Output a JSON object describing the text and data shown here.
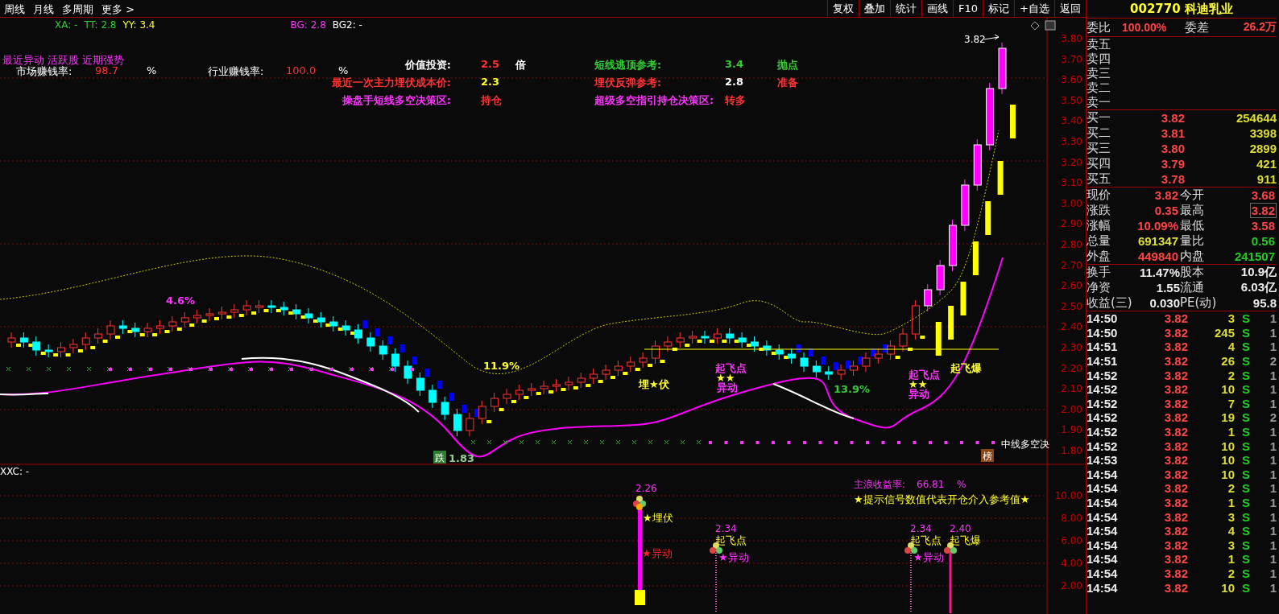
{
  "toolbar": {
    "periods": [
      "周线",
      "月线",
      "多周期",
      "更多 >"
    ],
    "buttons": [
      "复权",
      "叠加",
      "统计",
      "画线",
      "F10",
      "标记",
      "+自选",
      "返回"
    ]
  },
  "legend": [
    {
      "text": "XA: -",
      "color": "#33cc33"
    },
    {
      "text": "TT: 2.8",
      "color": "#33cc33"
    },
    {
      "text": "YY: 3.4",
      "color": "#ffff33"
    },
    {
      "text": "BG: 2.8",
      "color": "#ff33ff"
    },
    {
      "text": "BG2: -",
      "color": "#ffffff"
    }
  ],
  "info": {
    "title": "最近异动 活跃股 近期强势",
    "rates": [
      {
        "label": "市场赚钱率:",
        "value": "98.7",
        "unit": "%"
      },
      {
        "label": "行业赚钱率:",
        "value": "100.0",
        "unit": "%"
      }
    ],
    "rows": [
      {
        "a": {
          "label": {
            "text": "价值投资:",
            "color": "#ffffff"
          },
          "value": {
            "text": "2.5",
            "color": "#ff3333"
          },
          "unit": {
            "text": "倍",
            "color": "#ffffff"
          }
        },
        "b": {
          "label": {
            "text": "短线逃顶参考:",
            "color": "#33cc33"
          },
          "value": {
            "text": "3.4",
            "color": "#33cc33"
          },
          "unit": {
            "text": "抛点",
            "color": "#33cc33"
          }
        }
      },
      {
        "a": {
          "label": {
            "text": "最近一次主力埋伏成本价:",
            "color": "#ff3333"
          },
          "value": {
            "text": "2.3",
            "color": "#ffff33"
          }
        },
        "b": {
          "label": {
            "text": "埋伏反弹参考:",
            "color": "#ff3333"
          },
          "value": {
            "text": "2.8",
            "color": "#ffffff"
          },
          "unit": {
            "text": "准备",
            "color": "#ff3333"
          }
        }
      },
      {
        "a": {
          "label": {
            "text": "操盘手短线多空决策区:",
            "color": "#ff33ff"
          },
          "value": {
            "text": "持仓",
            "color": "#ff3333"
          }
        },
        "b": {
          "label": {
            "text": "超级多空指引持仓决策区:",
            "color": "#ff33ff"
          },
          "value": {
            "text": "转多",
            "color": "#ff3333"
          }
        }
      }
    ]
  },
  "chart": {
    "last_price": "3.82",
    "side_label": "中线多空决",
    "axis": [
      "3.80",
      "3.70",
      "3.60",
      "3.50",
      "3.40",
      "3.30",
      "3.20",
      "3.10",
      "3.00",
      "2.90",
      "2.80",
      "2.70",
      "2.60",
      "2.50",
      "2.40",
      "2.30",
      "2.20",
      "2.10",
      "2.00",
      "1.90",
      "1.80"
    ],
    "annotations": [
      {
        "text": "4.6%",
        "color": "#ff33ff"
      },
      {
        "text": "11.9%",
        "color": "#ffff33"
      },
      {
        "text": "1.83",
        "color": "#99cc99"
      },
      {
        "text": "13.9%",
        "color": "#33cc33"
      },
      {
        "text": "埋★伏",
        "color": "#ffff33"
      },
      {
        "text": "起飞点",
        "color": "#ff33ff"
      },
      {
        "text": "★★",
        "color": "#ffff33"
      },
      {
        "text": "异动",
        "color": "#ff33ff"
      },
      {
        "text": "起飞点",
        "color": "#ff33ff"
      },
      {
        "text": "★★",
        "color": "#ffff33"
      },
      {
        "text": "异动",
        "color": "#ff33ff"
      },
      {
        "text": "起飞爆",
        "color": "#ffff33"
      }
    ],
    "badges": [
      {
        "text": "跌",
        "color": "#2e7d32"
      },
      {
        "text": "榜",
        "color": "#8b4513"
      }
    ]
  },
  "indicator": {
    "title": "XXC: -",
    "stat": {
      "label": "主浪收益率:",
      "value": "66.81",
      "unit": "%"
    },
    "hint": "★提示信号数值代表开仓介入参考值★",
    "axis": [
      "10.00",
      "8.00",
      "6.00",
      "4.00",
      "2.00"
    ],
    "signals": [
      {
        "kind": "ambush",
        "value": "2.26",
        "label": "★埋伏",
        "tag": "★异动"
      },
      {
        "kind": "takeoff",
        "value": "2.34",
        "label": "起飞点",
        "tag": "★异动"
      },
      {
        "kind": "takeoff",
        "value": "2.34",
        "label": "起飞点",
        "tag": "★异动"
      },
      {
        "kind": "burst",
        "value": "2.40",
        "label": "起飞爆"
      }
    ]
  },
  "quote": {
    "code": "002770",
    "name": "科迪乳业",
    "ratio_label": "委比",
    "ratio": "100.00%",
    "diff_label": "委差",
    "diff": "26.2万",
    "asks": [
      "卖五",
      "卖四",
      "卖三",
      "卖二",
      "卖一"
    ],
    "bids": [
      {
        "label": "买一",
        "price": "3.82",
        "volume": "254644"
      },
      {
        "label": "买二",
        "price": "3.81",
        "volume": "3398"
      },
      {
        "label": "买三",
        "price": "3.80",
        "volume": "2899"
      },
      {
        "label": "买四",
        "price": "3.79",
        "volume": "421"
      },
      {
        "label": "买五",
        "price": "3.78",
        "volume": "911"
      }
    ],
    "stats": [
      {
        "label": "现价",
        "value": "3.82",
        "color": "#ff4444",
        "highlighted": false
      },
      {
        "label": "今开",
        "value": "3.68",
        "color": "#ff4444",
        "highlighted": false
      },
      {
        "label": "涨跌",
        "value": "0.35",
        "color": "#ff4444",
        "highlighted": false
      },
      {
        "label": "最高",
        "value": "3.82",
        "color": "#ff4444",
        "highlighted": true
      },
      {
        "label": "涨幅",
        "value": "10.09%",
        "color": "#ff4444",
        "highlighted": false
      },
      {
        "label": "最低",
        "value": "3.58",
        "color": "#ff4444",
        "highlighted": false
      },
      {
        "label": "总量",
        "value": "691347",
        "color": "#dddd33",
        "highlighted": false
      },
      {
        "label": "量比",
        "value": "0.56",
        "color": "#22cc22",
        "highlighted": false
      },
      {
        "label": "外盘",
        "value": "449840",
        "color": "#ff4444",
        "highlighted": false
      },
      {
        "label": "内盘",
        "value": "241507",
        "color": "#22cc22",
        "highlighted": false
      }
    ],
    "basics": [
      {
        "label": "换手",
        "value": "11.47%"
      },
      {
        "label": "股本",
        "value": "10.9亿"
      },
      {
        "label": "净资",
        "value": "1.55"
      },
      {
        "label": "流通",
        "value": "6.03亿"
      },
      {
        "label": "收益(三)",
        "value": "0.030"
      },
      {
        "label": "PE(动)",
        "value": "95.8"
      }
    ],
    "ticks": [
      {
        "time": "14:50",
        "price": "3.82",
        "volume": "3",
        "side": "S",
        "count": "1"
      },
      {
        "time": "14:50",
        "price": "3.82",
        "volume": "245",
        "side": "S",
        "count": "1"
      },
      {
        "time": "14:51",
        "price": "3.82",
        "volume": "4",
        "side": "S",
        "count": "1"
      },
      {
        "time": "14:51",
        "price": "3.82",
        "volume": "26",
        "side": "S",
        "count": "2"
      },
      {
        "time": "14:52",
        "price": "3.82",
        "volume": "2",
        "side": "S",
        "count": "1"
      },
      {
        "time": "14:52",
        "price": "3.82",
        "volume": "10",
        "side": "S",
        "count": "1"
      },
      {
        "time": "14:52",
        "price": "3.82",
        "volume": "7",
        "side": "S",
        "count": "1"
      },
      {
        "time": "14:52",
        "price": "3.82",
        "volume": "19",
        "side": "S",
        "count": "2"
      },
      {
        "time": "14:52",
        "price": "3.82",
        "volume": "1",
        "side": "S",
        "count": "1"
      },
      {
        "time": "14:52",
        "price": "3.82",
        "volume": "10",
        "side": "S",
        "count": "1"
      },
      {
        "time": "14:53",
        "price": "3.82",
        "volume": "10",
        "side": "S",
        "count": "1"
      },
      {
        "time": "14:54",
        "price": "3.82",
        "volume": "10",
        "side": "S",
        "count": "1"
      },
      {
        "time": "14:54",
        "price": "3.82",
        "volume": "2",
        "side": "S",
        "count": "1"
      },
      {
        "time": "14:54",
        "price": "3.82",
        "volume": "1",
        "side": "S",
        "count": "1"
      },
      {
        "time": "14:54",
        "price": "3.82",
        "volume": "3",
        "side": "S",
        "count": "1"
      },
      {
        "time": "14:54",
        "price": "3.82",
        "volume": "4",
        "side": "S",
        "count": "1"
      },
      {
        "time": "14:54",
        "price": "3.82",
        "volume": "3",
        "side": "S",
        "count": "1"
      },
      {
        "time": "14:54",
        "price": "3.82",
        "volume": "1",
        "side": "S",
        "count": "1"
      },
      {
        "time": "14:54",
        "price": "3.82",
        "volume": "2",
        "side": "S",
        "count": "1"
      },
      {
        "time": "14:54",
        "price": "3.82",
        "volume": "10",
        "side": "S",
        "count": "1"
      }
    ]
  }
}
